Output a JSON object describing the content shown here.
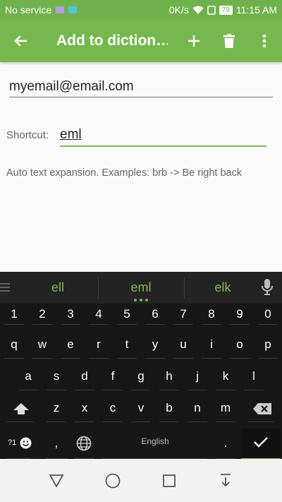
{
  "status_bar": {
    "carrier": "No service",
    "speed": "0K/s",
    "battery": "79",
    "time": "11:15 AM"
  },
  "toolbar": {
    "title": "Add to diction…",
    "back_icon": "arrow-left-icon",
    "add_icon": "plus-icon",
    "delete_icon": "trash-icon",
    "menu_icon": "more-vert-icon"
  },
  "form": {
    "word_value": "myemail@email.com",
    "shortcut_label": "Shortcut:",
    "shortcut_value": "eml",
    "hint": "Auto text expansion. Examples: brb -> Be right back"
  },
  "keyboard": {
    "suggestions": [
      "ell",
      "eml",
      "elk"
    ],
    "number_row": [
      "1",
      "2",
      "3",
      "4",
      "5",
      "6",
      "7",
      "8",
      "9",
      "0"
    ],
    "row1": [
      "q",
      "w",
      "e",
      "r",
      "t",
      "y",
      "u",
      "i",
      "o",
      "p"
    ],
    "row2": [
      "a",
      "s",
      "d",
      "f",
      "g",
      "h",
      "j",
      "k",
      "l"
    ],
    "row3": [
      "z",
      "x",
      "c",
      "v",
      "b",
      "n",
      "m"
    ],
    "symbols_label": "?1",
    "comma": ",",
    "space_label": "English",
    "period": ".",
    "accent_color": "#7cba52"
  },
  "colors": {
    "app_bar": "#75b94e",
    "status_bar": "#6fb24c"
  }
}
